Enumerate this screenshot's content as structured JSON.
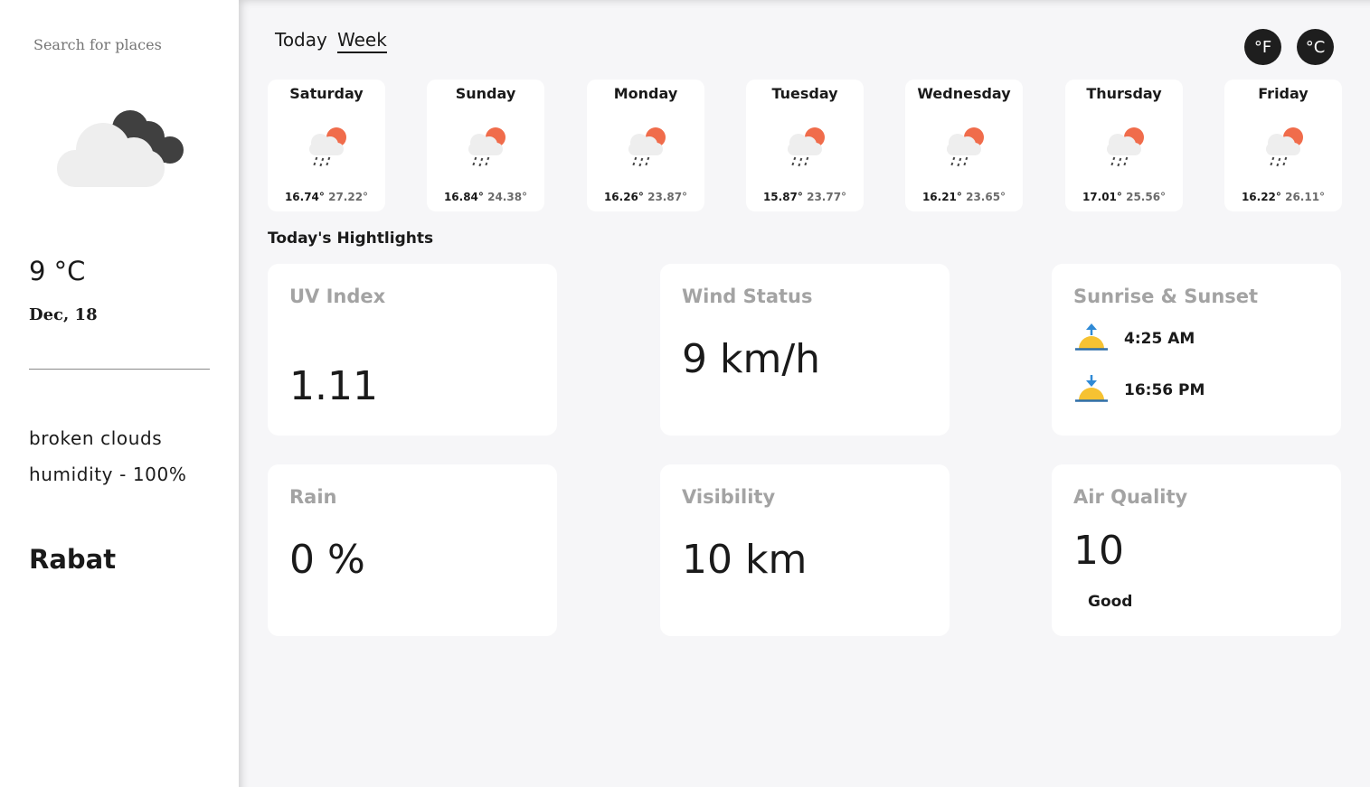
{
  "sidebar": {
    "search_placeholder": "Search for places",
    "weather_icon": "broken-clouds-icon",
    "temperature": "9 °C",
    "date": "Dec, 18",
    "description": "broken clouds",
    "humidity": "humidity - 100%",
    "city": "Rabat"
  },
  "header": {
    "tabs": [
      {
        "label": "Today",
        "active": false
      },
      {
        "label": "Week",
        "active": true
      }
    ],
    "units": [
      {
        "label": "°F"
      },
      {
        "label": "°C"
      }
    ]
  },
  "forecast": [
    {
      "day": "Saturday",
      "min": "16.74°",
      "max": "27.22°",
      "icon": "rain-sun-icon"
    },
    {
      "day": "Sunday",
      "min": "16.84°",
      "max": "24.38°",
      "icon": "rain-sun-icon"
    },
    {
      "day": "Monday",
      "min": "16.26°",
      "max": "23.87°",
      "icon": "rain-sun-icon"
    },
    {
      "day": "Tuesday",
      "min": "15.87°",
      "max": "23.77°",
      "icon": "rain-sun-icon"
    },
    {
      "day": "Wednesday",
      "min": "16.21°",
      "max": "23.65°",
      "icon": "rain-sun-icon"
    },
    {
      "day": "Thursday",
      "min": "17.01°",
      "max": "25.56°",
      "icon": "rain-sun-icon"
    },
    {
      "day": "Friday",
      "min": "16.22°",
      "max": "26.11°",
      "icon": "rain-sun-icon"
    }
  ],
  "highlights": {
    "title": "Today's Hightlights",
    "uv": {
      "title": "UV Index",
      "value": "1.11"
    },
    "wind": {
      "title": "Wind Status",
      "value": "9 km/h"
    },
    "sun": {
      "title": "Sunrise & Sunset",
      "sunrise": "4:25 AM",
      "sunset": "16:56 PM"
    },
    "rain": {
      "title": "Rain",
      "value": "0 %"
    },
    "visibility": {
      "title": "Visibility",
      "value": "10 km"
    },
    "air": {
      "title": "Air Quality",
      "value": "10",
      "label": "Good"
    }
  },
  "colors": {
    "background": "#f6f6f8",
    "card": "#ffffff",
    "accent_sun": "#f06c4b",
    "muted_text": "#a3a3a3",
    "button": "#1e1e1e"
  }
}
